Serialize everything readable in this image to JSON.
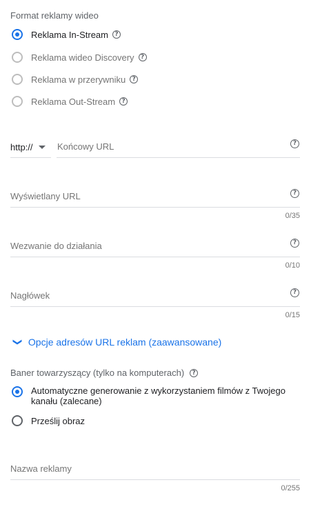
{
  "format": {
    "title": "Format reklamy wideo",
    "options": [
      {
        "label": "Reklama In-Stream",
        "selected": true
      },
      {
        "label": "Reklama wideo Discovery",
        "selected": false
      },
      {
        "label": "Reklama w przerywniku",
        "selected": false
      },
      {
        "label": "Reklama Out-Stream",
        "selected": false
      }
    ]
  },
  "help_glyph": "?",
  "final_url": {
    "protocol": "http://",
    "placeholder": "Końcowy URL"
  },
  "display_url": {
    "label": "Wyświetlany URL",
    "counter": "0/35"
  },
  "cta": {
    "label": "Wezwanie do działania",
    "counter": "0/10"
  },
  "headline": {
    "label": "Nagłówek",
    "counter": "0/15"
  },
  "advanced": {
    "chevron": "❯",
    "label": "Opcje adresów URL reklam (zaawansowane)"
  },
  "companion": {
    "title": "Baner towarzyszący (tylko na komputerach)",
    "options": [
      {
        "label_line1": "Automatyczne generowanie z wykorzystaniem filmów z Twojego",
        "label_line2": "kanału (zalecane)",
        "selected": true
      },
      {
        "label": "Prześlij obraz",
        "selected": false
      }
    ]
  },
  "ad_name": {
    "label": "Nazwa reklamy",
    "counter": "0/255"
  },
  "colors": {
    "accent": "#1a73e8",
    "muted": "#757575",
    "divider": "#dadce0"
  }
}
